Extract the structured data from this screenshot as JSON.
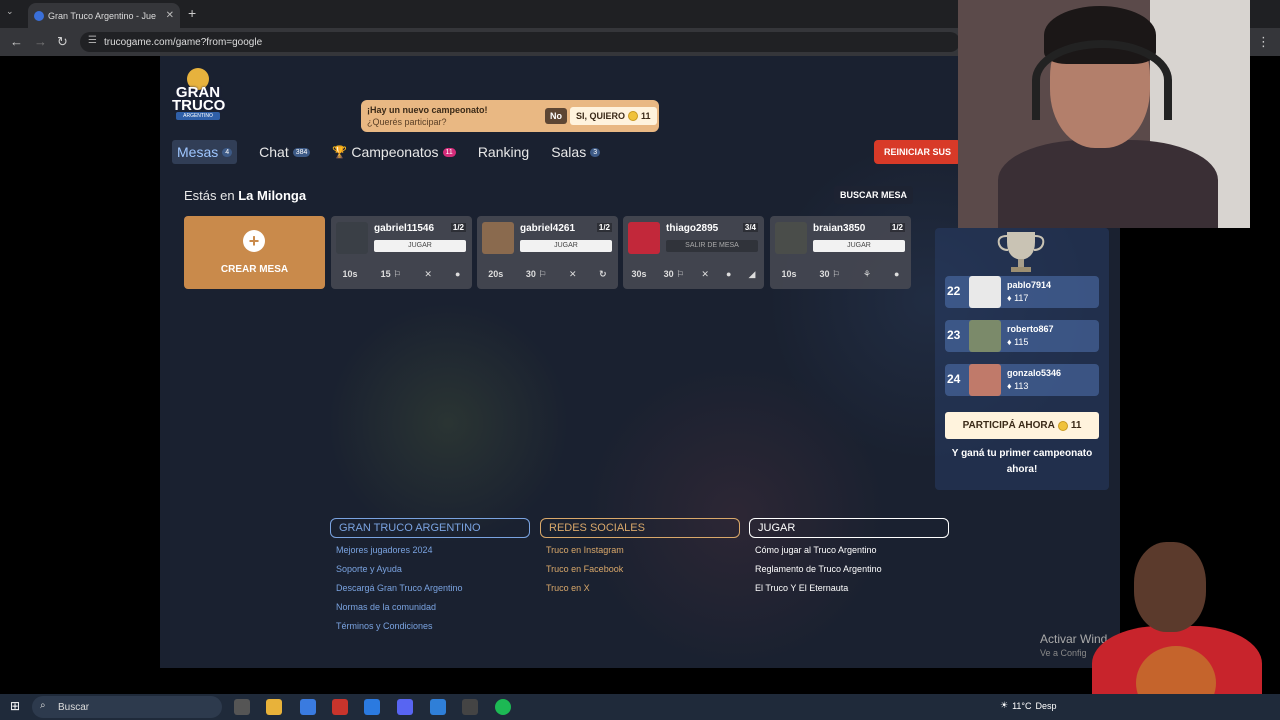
{
  "browser": {
    "tab_title": "Gran Truco Argentino - Jue",
    "url": "trucogame.com/game?from=google",
    "new_tab": "+",
    "tab_close": "✕"
  },
  "logo": {
    "line1": "GRAN",
    "line2": "TRUCO",
    "line3": "ARGENTINO"
  },
  "promo": {
    "title": "¡Hay un nuevo campeonato!",
    "question": "¿Querés participar?",
    "no_label": "No",
    "yes_label": "SI, QUIERO",
    "yes_count": "11"
  },
  "nav": {
    "mesas": "Mesas",
    "mesas_badge": "4",
    "chat": "Chat",
    "chat_badge": "384",
    "campeonatos": "Campeonatos",
    "campeonatos_badge": "11",
    "ranking": "Ranking",
    "salas": "Salas",
    "salas_badge": "3",
    "restart": "REINICIAR SUS"
  },
  "lobby": {
    "where_prefix": "Estás en",
    "where_room": "La Milonga",
    "buscar": "BUSCAR MESA",
    "crear": "CREAR MESA",
    "mesas": [
      {
        "name": "gabriel11546",
        "count": "1/2",
        "button": "JUGAR",
        "time": "10s",
        "points": "15 ⚐"
      },
      {
        "name": "gabriel4261",
        "count": "1/2",
        "button": "JUGAR",
        "time": "20s",
        "points": "30 ⚐"
      },
      {
        "name": "thiago2895",
        "count": "3/4",
        "button": "SALIR DE MESA",
        "time": "30s",
        "points": "30 ⚐"
      },
      {
        "name": "braian3850",
        "count": "1/2",
        "button": "JUGAR",
        "time": "10s",
        "points": "30 ⚐"
      }
    ]
  },
  "ranking": {
    "rows": [
      {
        "pos": "22",
        "name": "pablo7914",
        "points": "117"
      },
      {
        "pos": "23",
        "name": "roberto867",
        "points": "115"
      },
      {
        "pos": "24",
        "name": "gonzalo5346",
        "points": "113"
      }
    ],
    "participa": "PARTICIPÁ AHORA",
    "participa_count": "11",
    "gana": "Y ganá tu primer campeonato ahora!"
  },
  "footer": {
    "col1_title": "GRAN TRUCO ARGENTINO",
    "col1": [
      "Mejores jugadores 2024",
      "Soporte y Ayuda",
      "Descargá Gran Truco Argentino",
      "Normas de la comunidad",
      "Términos y Condiciones"
    ],
    "col2_title": "REDES SOCIALES",
    "col2": [
      "Truco en Instagram",
      "Truco en Facebook",
      "Truco en X"
    ],
    "col3_title": "JUGAR",
    "col3": [
      "Cómo jugar al Truco Argentino",
      "Reglamento de Truco Argentino",
      "El Truco Y El Eternauta"
    ]
  },
  "windows": {
    "activate": "Activar Wind",
    "activate_sub": "Ve a Config",
    "search": "Buscar",
    "weather": "11°C",
    "weather_desc": "Desp"
  },
  "colors": {
    "accent": "#c98a4b",
    "promo": "#e9b883",
    "restart": "#d83a28",
    "link_blue": "#7aa3e0"
  }
}
